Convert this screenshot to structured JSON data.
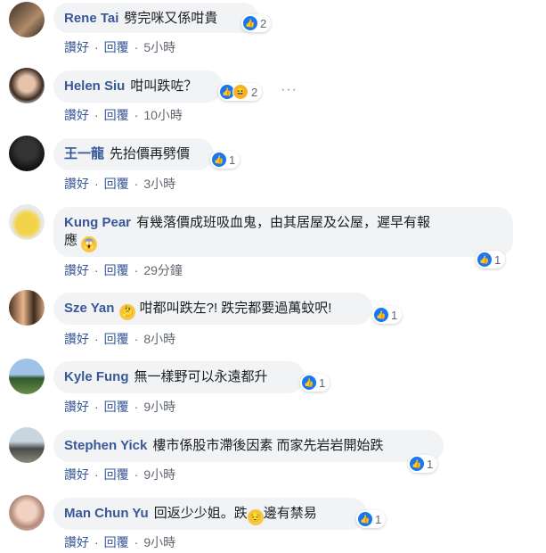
{
  "actions": {
    "like": "讚好",
    "reply": "回覆",
    "sep": "·"
  },
  "more_label": "···",
  "comments": [
    {
      "name": "Rene Tai",
      "text": "劈完咪又係咁貴",
      "like_count": "2",
      "time": "5小時"
    },
    {
      "name": "Helen Siu",
      "text": "咁叫跌咗？",
      "like_count": "2",
      "time": "10小時"
    },
    {
      "name": "王一龍",
      "text": "先抬價再劈價",
      "like_count": "1",
      "time": "3小時"
    },
    {
      "name": "Kung Pear",
      "text": "有幾落價成班吸血鬼，由其居屋及公屋，遲早有報",
      "text2": "應",
      "like_count": "1",
      "time": "29分鐘"
    },
    {
      "name": "Sze Yan",
      "text": "咁都叫跌左?! 跌完都要過萬蚊呎!",
      "like_count": "1",
      "time": "8小時"
    },
    {
      "name": "Kyle Fung",
      "text": "無一樣野可以永遠都升",
      "like_count": "1",
      "time": "9小時"
    },
    {
      "name": "Stephen Yick",
      "text": "樓市係股市滯後因素 而家先岩岩開始跌",
      "like_count": "1",
      "time": "9小時"
    },
    {
      "name": "Man Chun Yu",
      "text": "回返少少姐。跌",
      "text2": "邊有禁易",
      "like_count": "1",
      "time": "9小時"
    }
  ],
  "colors": {
    "name": "#385898",
    "bubble": "#f2f3f5",
    "like": "#1877f2"
  }
}
